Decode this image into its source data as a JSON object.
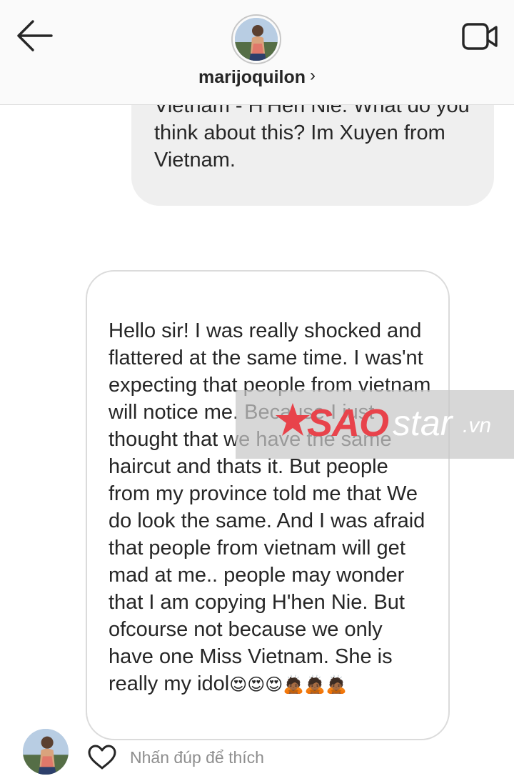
{
  "header": {
    "username": "marijoquilon",
    "chevron": "›",
    "back_icon": "back-arrow-icon",
    "video_icon": "video-call-icon"
  },
  "messages": {
    "sent": {
      "text": "Vietnam - H'Hen Nie. What do you think about this? Im Xuyen from Vietnam."
    },
    "received": {
      "text": "Hello sir! I was really shocked and flattered at the same time. I was'nt expecting that people from vietnam will notice me. Because I just thought that we have the same haircut and thats it. But people from my province told me that We do look the same. And I was afraid that people from vietnam will get mad at me.. people may wonder that I am copying H'hen Nie. But ofcourse not because we only have one Miss Vietnam. She is really my idol",
      "emojis": "😍😍😍🙇🏾🙇🏾🙇🏾"
    }
  },
  "footer": {
    "like_hint": "Nhấn đúp để thích",
    "like_icon": "heart-icon"
  },
  "watermark": {
    "brand": "SAO",
    "suffix": "star",
    "domain": ".vn"
  },
  "colors": {
    "header_bg": "#fafafa",
    "sent_bubble": "#efefef",
    "received_border": "#dbdbdb",
    "text": "#262626",
    "muted": "#8e8e8e",
    "watermark_red": "#e8434b"
  }
}
